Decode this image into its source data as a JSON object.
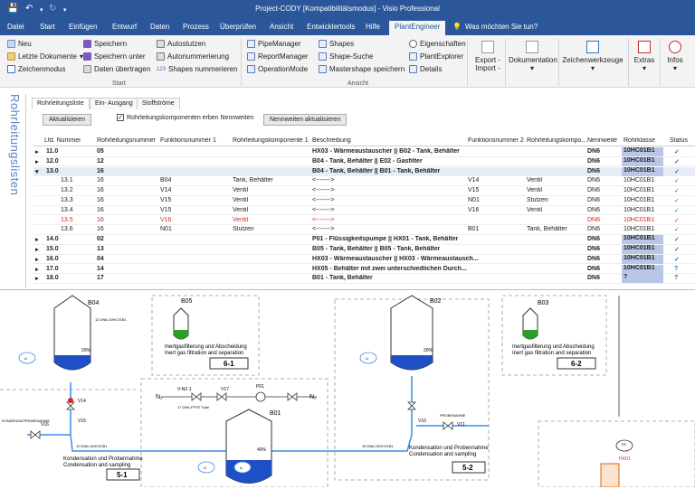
{
  "window": {
    "title": "Project-CODY  [Kompatibilitätsmodus]  -  Visio Professional"
  },
  "tabs": [
    {
      "label": "Datei"
    },
    {
      "label": "Start"
    },
    {
      "label": "Einfügen"
    },
    {
      "label": "Entwurf"
    },
    {
      "label": "Daten"
    },
    {
      "label": "Prozess"
    },
    {
      "label": "Überprüfen"
    },
    {
      "label": "Ansicht"
    },
    {
      "label": "Entwicklertools"
    },
    {
      "label": "Hilfe"
    },
    {
      "label": "PlantEngineer"
    }
  ],
  "tellme": "Was möchten Sie tun?",
  "ribbon": {
    "start": {
      "neu": "Neu",
      "letzte": "Letzte Dokumente",
      "zeichenmodus": "Zeichenmodus",
      "speichern": "Speichern",
      "speichern_unter": "Speichern unter",
      "daten_uebertragen": "Daten übertragen",
      "autostutzen": "Autostutzen",
      "autonummerierung": "Autonummerierung",
      "shapes_nummerieren": "Shapes nummerieren",
      "group": "Start"
    },
    "ansicht": {
      "pipemanager": "PipeManager",
      "reportmanager": "ReportManager",
      "operationmode": "OperationMode",
      "shapes": "Shapes",
      "shape_suche": "Shape-Suche",
      "mastershape": "Mastershape speichern",
      "eigenschaften": "Eigenschaften",
      "plantexplorer": "PlantExplorer",
      "details": "Details",
      "group": "Ansicht"
    },
    "export": "Export -",
    "import": "Import -",
    "dokumentation": "Dokumentation",
    "zeichenwerkzeuge": "Zeichenwerkzeuge",
    "extras": "Extras",
    "infos": "Infos"
  },
  "side_label": "Rohrleitungslisten",
  "panel": {
    "tabs": [
      "Rohrleitungsliste",
      "Ein- Ausgang",
      "Stoffströme"
    ],
    "btn_aktualisieren": "Aktualisieren",
    "chk_label": "Rohrleitungskomponenten erben Nennweiten",
    "chk_mark": "✓",
    "btn_nennweiten": "Nennweiten aktualisieren"
  },
  "table": {
    "columns": [
      "Lfd. Nummer",
      "Rohrleitungsnummer",
      "Funktionsnummer 1",
      "Rohrleitungskomponente 1",
      "Beschreibung",
      "Funktionsnummer 2",
      "Rohrleitungskompo...",
      "Nennweite",
      "Rohrklasse",
      "Status"
    ],
    "rows": [
      {
        "exp": "▸",
        "lfd": "11.0",
        "rnr": "05",
        "fn1": "",
        "rk1": "",
        "desc": "HX03 - Wärmeaustauscher || B02 - Tank, Behälter",
        "fn2": "",
        "rk2": "",
        "dn": "DN6",
        "rkl": "10HC01B1",
        "st": "✓",
        "type": "bold"
      },
      {
        "exp": "▸",
        "lfd": "12.0",
        "rnr": "12",
        "fn1": "",
        "rk1": "",
        "desc": "B04 - Tank, Behälter || E02 - Gasfilter",
        "fn2": "",
        "rk2": "",
        "dn": "DN6",
        "rkl": "10HC01B1",
        "st": "✓",
        "type": "bold"
      },
      {
        "exp": "▾",
        "lfd": "13.0",
        "rnr": "16",
        "fn1": "",
        "rk1": "",
        "desc": "B04 - Tank, Behälter || B01 - Tank, Behälter",
        "fn2": "",
        "rk2": "",
        "dn": "DN6",
        "rkl": "10HC01B1",
        "st": "✓",
        "type": "bold sel"
      },
      {
        "exp": "",
        "lfd": "13.1",
        "rnr": "16",
        "fn1": "B04",
        "rk1": "Tank, Behälter",
        "desc": "<------->",
        "fn2": "V14",
        "rk2": "Ventil",
        "dn": "DN6",
        "rkl": "10HC01B1",
        "st": "✓",
        "type": "sub"
      },
      {
        "exp": "",
        "lfd": "13.2",
        "rnr": "16",
        "fn1": "V14",
        "rk1": "Ventil",
        "desc": "<------->",
        "fn2": "V15",
        "rk2": "Ventil",
        "dn": "DN6",
        "rkl": "10HC01B1",
        "st": "✓",
        "type": "sub"
      },
      {
        "exp": "",
        "lfd": "13.3",
        "rnr": "16",
        "fn1": "V15",
        "rk1": "Ventil",
        "desc": "<------->",
        "fn2": "N01",
        "rk2": "Stutzen",
        "dn": "DN6",
        "rkl": "10HC01B1",
        "st": "✓",
        "type": "sub"
      },
      {
        "exp": "",
        "lfd": "13.4",
        "rnr": "16",
        "fn1": "V15",
        "rk1": "Ventil",
        "desc": "<------->",
        "fn2": "V16",
        "rk2": "Ventil",
        "dn": "DN6",
        "rkl": "10HC01B1",
        "st": "✓",
        "type": "sub"
      },
      {
        "exp": "",
        "lfd": "13.5",
        "rnr": "16",
        "fn1": "V16",
        "rk1": "Ventil",
        "desc": "<------->",
        "fn2": "",
        "rk2": "",
        "dn": "DN6",
        "rkl": "10HC01B1",
        "st": "✓",
        "type": "red"
      },
      {
        "exp": "",
        "lfd": "13.6",
        "rnr": "16",
        "fn1": "N01",
        "rk1": "Stutzen",
        "desc": "<------->",
        "fn2": "B01",
        "rk2": "Tank, Behälter",
        "dn": "DN6",
        "rkl": "10HC01B1",
        "st": "✓",
        "type": "sub"
      },
      {
        "exp": "▸",
        "lfd": "14.0",
        "rnr": "02",
        "fn1": "",
        "rk1": "",
        "desc": "P01 - Flüssigkeitspumpe || HX01 - Tank, Behälter",
        "fn2": "",
        "rk2": "",
        "dn": "DN6",
        "rkl": "10HC01B1",
        "st": "✓",
        "type": "bold"
      },
      {
        "exp": "▸",
        "lfd": "15.0",
        "rnr": "13",
        "fn1": "",
        "rk1": "",
        "desc": "B05 - Tank, Behälter || B05 - Tank, Behälter",
        "fn2": "",
        "rk2": "",
        "dn": "DN6",
        "rkl": "10HC01B1",
        "st": "✓",
        "type": "bold"
      },
      {
        "exp": "▸",
        "lfd": "16.0",
        "rnr": "04",
        "fn1": "",
        "rk1": "",
        "desc": "HX03 - Wärmeaustauscher || HX03 - Wärmeaustausch...",
        "fn2": "",
        "rk2": "",
        "dn": "DN6",
        "rkl": "10HC01B1",
        "st": "✓",
        "type": "bold"
      },
      {
        "exp": "▸",
        "lfd": "17.0",
        "rnr": "14",
        "fn1": "",
        "rk1": "",
        "desc": "HX05 - Behälter mit zwei unterschiedlichen Durch...",
        "fn2": "",
        "rk2": "",
        "dn": "DN6",
        "rkl": "10HC01B1",
        "st": "?",
        "type": "bold"
      },
      {
        "exp": "▸",
        "lfd": "18.0",
        "rnr": "17",
        "fn1": "",
        "rk1": "",
        "desc": "B01 - Tank, Behälter",
        "fn2": "",
        "rk2": "",
        "dn": "DN6",
        "rkl": "?",
        "st": "?",
        "type": "bold"
      }
    ]
  },
  "drawing": {
    "labels": {
      "b04": "B04",
      "b02": "B02",
      "b03": "B03",
      "b05": "B05",
      "b01": "B01",
      "inert1_de": "Inertgasfilterung und Abscheidung",
      "inert1_en": "Inert gas filtration and separation",
      "box61": "6-1",
      "inert2_de": "Inertgasfilterung und Abscheidung",
      "inert2_en": "Inert gas filtration and separation",
      "box62": "6-2",
      "kond1_de": "Kondensation und Probennahme",
      "kond1_en": "Condensation and sampling",
      "box51": "5-1",
      "kond2_de": "Kondensation und Probennahme",
      "kond2_en": "Condensation and sampling",
      "box52": "5-2",
      "n2a": "N₂",
      "n2b": "N₂",
      "v12": "V-N2-1",
      "v17": "V17",
      "p01": "P01",
      "v16": "V16",
      "v14": "V14",
      "v15": "V15",
      "v11": "V11",
      "v10": "V10",
      "probe1": "KONDENSATPROBENAHME",
      "probe2": "PROBENAHME",
      "hx01": "HX01",
      "p20a": "20%",
      "p20b": "20%",
      "p40": "40%",
      "t1": "12 DN6-10HC01B1",
      "t2": "10 DN6-10HC01B1",
      "t3": "15 DN6-10HC01B1",
      "t4": "17 DN6-PTFE Tube",
      "l1": "LI",
      "l2": "LI",
      "l3": "LI",
      "l4": "LI",
      "ti": "TIC"
    }
  }
}
